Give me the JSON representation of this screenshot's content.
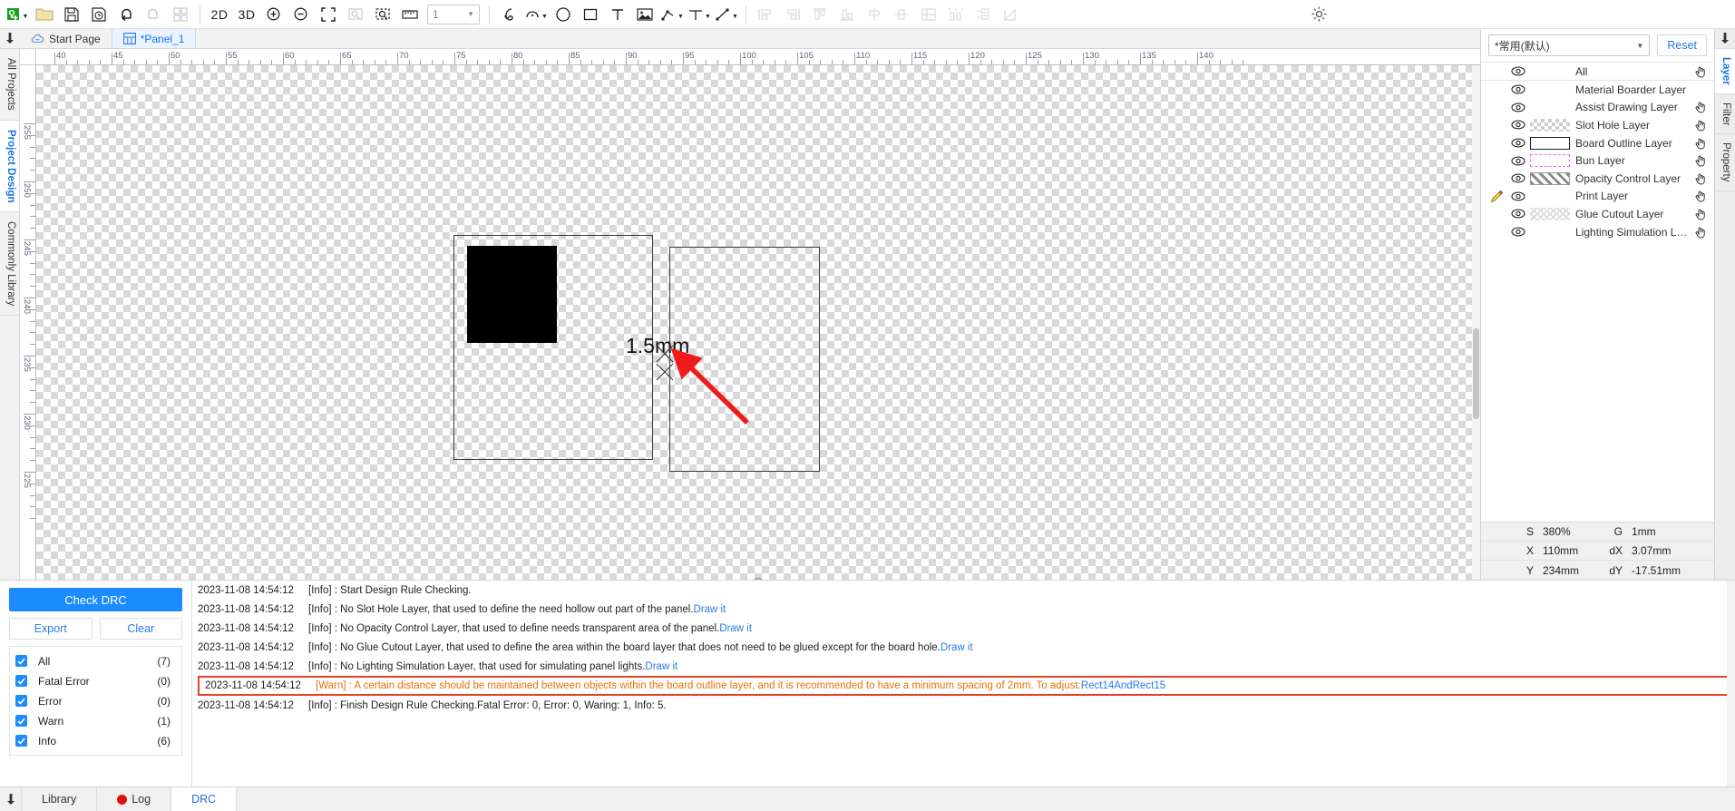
{
  "toolbar": {
    "items": [
      {
        "name": "new-project-button",
        "icon": "new-doc-green",
        "disabled": false,
        "caret": true
      },
      {
        "name": "open-folder-button",
        "icon": "folder",
        "disabled": false
      },
      {
        "name": "save-button",
        "icon": "save-disk",
        "disabled": false
      },
      {
        "name": "save-as-button",
        "icon": "save-as",
        "disabled": false
      },
      {
        "name": "undo-button",
        "icon": "undo-arrow",
        "disabled": false
      },
      {
        "name": "redo-button",
        "icon": "redo-arrow",
        "disabled": true
      },
      {
        "name": "grid-button",
        "icon": "grid-four",
        "disabled": true
      }
    ],
    "view_2d_label": "2D",
    "view_3d_label": "3D",
    "zoom_in_label": "zoom-in-icon",
    "zoom_out_label": "zoom-out-icon",
    "fit_label": "fit-screen-icon",
    "zoom_area_label": "zoom-area-icon",
    "zoom_select_label": "zoom-selection-icon",
    "measure_label": "measure-icon",
    "layer_select_value": "1",
    "draw_tools": [
      {
        "name": "pen-tool",
        "icon": "pen"
      },
      {
        "name": "arc-tool",
        "icon": "arc",
        "caret": true
      },
      {
        "name": "circle-tool",
        "icon": "circle"
      },
      {
        "name": "rect-tool",
        "icon": "rectangle"
      },
      {
        "name": "text-tool",
        "icon": "text-T"
      },
      {
        "name": "image-tool",
        "icon": "image"
      },
      {
        "name": "polyline-tool",
        "icon": "polyline",
        "caret": true
      },
      {
        "name": "dimension-tool",
        "icon": "dimension",
        "caret": true
      },
      {
        "name": "line-tool",
        "icon": "line",
        "caret": true
      }
    ],
    "align_tools": [
      {
        "name": "align-left",
        "icon": "align-left"
      },
      {
        "name": "align-right",
        "icon": "align-right"
      },
      {
        "name": "align-top",
        "icon": "align-top"
      },
      {
        "name": "align-bottom",
        "icon": "align-bottom"
      },
      {
        "name": "align-center-h",
        "icon": "align-center-h"
      },
      {
        "name": "align-center-v",
        "icon": "align-center-v"
      },
      {
        "name": "distribute-grid",
        "icon": "distribute-grid"
      },
      {
        "name": "distribute-h",
        "icon": "distribute-h"
      },
      {
        "name": "distribute-v",
        "icon": "distribute-v"
      },
      {
        "name": "mirror",
        "icon": "mirror"
      }
    ],
    "settings_label": "gear-icon"
  },
  "tabstrip": {
    "pin": "pin-icon",
    "tabs": [
      {
        "label": "Start Page",
        "icon": "cloud-icon",
        "active": false
      },
      {
        "label": "*Panel_1",
        "icon": "panel-grid-icon",
        "active": true
      }
    ]
  },
  "left_rail": {
    "tabs": [
      {
        "label": "All Projects",
        "active": false
      },
      {
        "label": "Project Design",
        "active": true
      },
      {
        "label": "Commonly Library",
        "active": false
      }
    ]
  },
  "canvas": {
    "ruler_h_labels": [
      "40",
      "45",
      "50",
      "55",
      "60",
      "65",
      "70",
      "75",
      "80",
      "85",
      "90",
      "95",
      "100",
      "105",
      "110",
      "115",
      "120",
      "125",
      "130",
      "135",
      "140"
    ],
    "ruler_v_labels": [
      "255",
      "250",
      "245",
      "240",
      "235",
      "230",
      "225"
    ],
    "dimension_label": "1.5mm",
    "shapes": [
      {
        "name": "board-outline-rect14",
        "type": "rect"
      },
      {
        "name": "board-outline-rect15",
        "type": "rect"
      },
      {
        "name": "black-filled-rect",
        "type": "rect-filled"
      }
    ],
    "annotation": {
      "name": "red-arrow-annotation",
      "color": "#ef1b1b"
    }
  },
  "right_panel": {
    "preset_value": "*常用(默认)",
    "reset_label": "Reset",
    "layers": [
      {
        "label": "All",
        "swatch": "none",
        "eye": true,
        "pencil": false,
        "hand": true
      },
      {
        "label": "Material Boarder Layer",
        "swatch": "none",
        "eye": true,
        "pencil": false,
        "hand": false
      },
      {
        "label": "Assist Drawing Layer",
        "swatch": "none",
        "eye": true,
        "pencil": false,
        "hand": true
      },
      {
        "label": "Slot Hole Layer",
        "swatch": "check",
        "eye": true,
        "pencil": false,
        "hand": true
      },
      {
        "label": "Board Outline Layer",
        "swatch": "outline",
        "eye": true,
        "pencil": false,
        "hand": true
      },
      {
        "label": "Bun Layer",
        "swatch": "bun",
        "eye": true,
        "pencil": false,
        "hand": true
      },
      {
        "label": "Opacity Control Layer",
        "swatch": "hatch",
        "eye": true,
        "pencil": false,
        "hand": true
      },
      {
        "label": "Print Layer",
        "swatch": "none",
        "eye": true,
        "pencil": true,
        "hand": true
      },
      {
        "label": "Glue Cutout Layer",
        "swatch": "glue",
        "eye": true,
        "pencil": false,
        "hand": true
      },
      {
        "label": "Lighting Simulation L…",
        "swatch": "none",
        "eye": true,
        "pencil": false,
        "hand": true
      }
    ],
    "status": [
      {
        "k1": "S",
        "v1": "380%",
        "k2": "G",
        "v2": "1mm"
      },
      {
        "k1": "X",
        "v1": "110mm",
        "k2": "dX",
        "v2": "3.07mm"
      },
      {
        "k1": "Y",
        "v1": "234mm",
        "k2": "dY",
        "v2": "-17.51mm"
      }
    ]
  },
  "right_rail": {
    "pin": "pin-icon",
    "tabs": [
      {
        "label": "Layer",
        "active": true
      },
      {
        "label": "Filter",
        "active": false
      },
      {
        "label": "Property",
        "active": false
      }
    ]
  },
  "drc": {
    "check_label": "Check DRC",
    "export_label": "Export",
    "clear_label": "Clear",
    "filters": [
      {
        "label": "All",
        "count": "(7)",
        "checked": true
      },
      {
        "label": "Fatal Error",
        "count": "(0)",
        "checked": true
      },
      {
        "label": "Error",
        "count": "(0)",
        "checked": true
      },
      {
        "label": "Warn",
        "count": "(1)",
        "checked": true
      },
      {
        "label": "Info",
        "count": "(6)",
        "checked": true
      }
    ],
    "log": [
      {
        "ts": "2023-11-08 14:54:12",
        "level": "[Info]",
        "text": " : Start Design Rule Checking.",
        "link": "",
        "warn": false
      },
      {
        "ts": "2023-11-08 14:54:12",
        "level": "[Info]",
        "text": " : No Slot Hole Layer, that used to define the need hollow out part of the panel.",
        "link": "Draw it",
        "warn": false
      },
      {
        "ts": "2023-11-08 14:54:12",
        "level": "[Info]",
        "text": " : No Opacity Control Layer, that used to define needs transparent area of the panel.",
        "link": "Draw it",
        "warn": false
      },
      {
        "ts": "2023-11-08 14:54:12",
        "level": "[Info]",
        "text": " : No Glue Cutout Layer, that used to define the area within the board layer that does not need to be glued except for the board hole.",
        "link": "Draw it",
        "warn": false
      },
      {
        "ts": "2023-11-08 14:54:12",
        "level": "[Info]",
        "text": " : No Lighting Simulation Layer, that used for simulating panel lights.",
        "link": "Draw it",
        "warn": false
      },
      {
        "ts": "2023-11-08 14:54:12",
        "level": "[Warn]",
        "text": " : A certain distance should be maintained between objects within the board outline layer, and it is recommended to have a minimum spacing of 2mm. To adjust:",
        "link": "Rect14AndRect15",
        "warn": true
      },
      {
        "ts": "2023-11-08 14:54:12",
        "level": "[Info]",
        "text": " : Finish Design Rule Checking.Fatal Error: 0, Error: 0, Waring: 1, Info: 5.",
        "link": "",
        "warn": false
      }
    ]
  },
  "bottom_bar": {
    "pin": "pin-icon",
    "tabs": [
      {
        "label": "Library",
        "dot": false,
        "active": false
      },
      {
        "label": "Log",
        "dot": true,
        "active": false
      },
      {
        "label": "DRC",
        "dot": false,
        "active": true
      }
    ]
  }
}
